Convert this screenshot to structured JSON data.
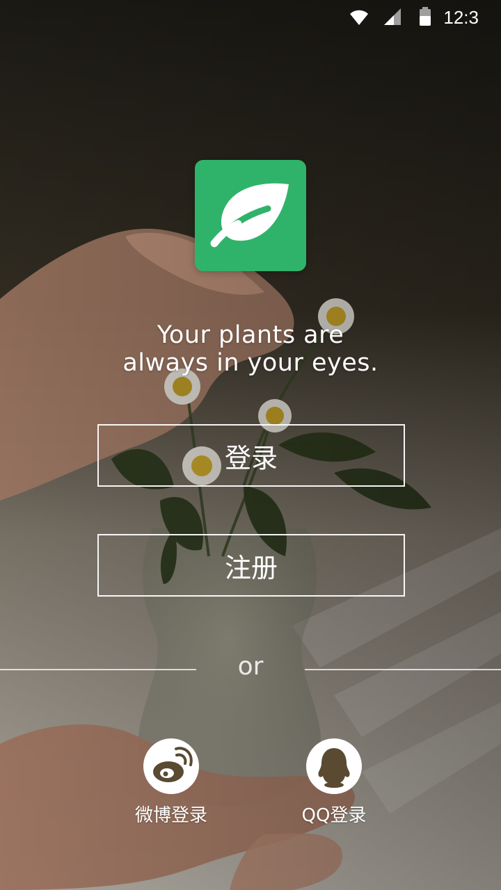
{
  "status_bar": {
    "time": "12:3",
    "icons": [
      "wifi-icon",
      "cellular-signal-icon",
      "battery-icon"
    ]
  },
  "app": {
    "logo_icon": "leaf-icon",
    "brand_color": "#2fb36b"
  },
  "tagline": {
    "line1": "Your plants are",
    "line2": "always in your eyes."
  },
  "buttons": {
    "login_label": "登录",
    "register_label": "注册"
  },
  "divider": {
    "text": "or"
  },
  "social": {
    "weibo_label": "微博登录",
    "weibo_icon": "weibo-icon",
    "qq_label": "QQ登录",
    "qq_icon": "qq-icon"
  }
}
